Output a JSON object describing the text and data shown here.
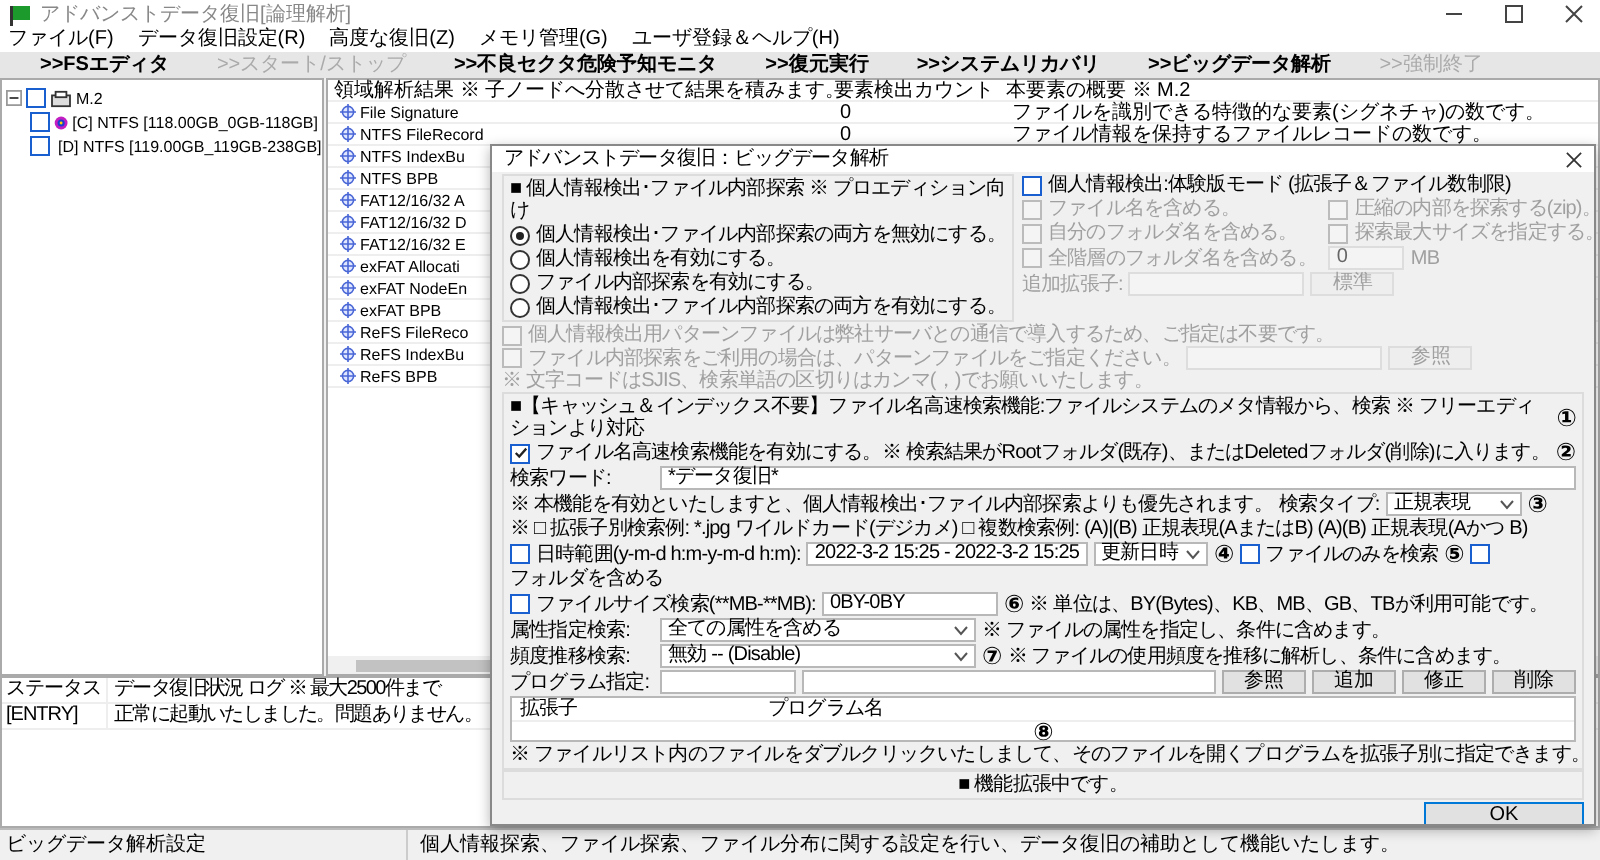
{
  "window": {
    "title": "アドバンストデータ復旧[論理解析]"
  },
  "menu": [
    "ファイル(F)",
    "データ復旧設定(R)",
    "高度な復旧(Z)",
    "メモリ管理(G)",
    "ユーザ登録＆ヘルプ(H)"
  ],
  "toolbar": [
    {
      "label": ">>FSエディタ",
      "disabled": false
    },
    {
      "label": ">>スタート/ストップ",
      "disabled": true
    },
    {
      "label": ">>不良セクタ危険予知モニタ",
      "disabled": false
    },
    {
      "label": ">>復元実行",
      "disabled": false
    },
    {
      "label": ">>システムリカバリ",
      "disabled": false
    },
    {
      "label": ">>ビッグデータ解析",
      "disabled": false
    },
    {
      "label": ">>強制終了",
      "disabled": true
    }
  ],
  "tree": {
    "label": "M.2",
    "checked": false,
    "expanded": true,
    "children": [
      {
        "label": "[C] NTFS [118.00GB_0GB-118GB]",
        "checked": false
      },
      {
        "label": "[D] NTFS [119.00GB_119GB-238GB]",
        "checked": false
      }
    ]
  },
  "table": {
    "columns": [
      "領域解析結果 ※ 子ノードへ分散させて結果を積みます。",
      "要素検出カウント",
      "本要素の概要 ※ M.2"
    ],
    "rows": [
      {
        "name": "File Signature",
        "count": "0",
        "description": "ファイルを識別できる特徴的な要素(シグネチャ)の数です。"
      },
      {
        "name": "NTFS FileRecord",
        "count": "0",
        "description": "ファイル情報を保持するファイルレコードの数です。"
      },
      {
        "name": "NTFS IndexBu"
      },
      {
        "name": "NTFS BPB"
      },
      {
        "name": "FAT12/16/32 A"
      },
      {
        "name": "FAT12/16/32 D"
      },
      {
        "name": "FAT12/16/32 E"
      },
      {
        "name": "exFAT Allocati"
      },
      {
        "name": "exFAT NodeEn"
      },
      {
        "name": "exFAT BPB"
      },
      {
        "name": "ReFS FileReco"
      },
      {
        "name": "ReFS IndexBu"
      },
      {
        "name": "ReFS BPB"
      }
    ]
  },
  "log": {
    "columns": [
      "ステータス",
      "データ復旧状況 ログ ※ 最大2500件まで"
    ],
    "rows": [
      {
        "status": "[ENTRY]",
        "message": "正常に起動いたしました。問題ありません。"
      }
    ]
  },
  "status_bar": [
    "ビッグデータ解析設定",
    "個人情報探索、ファイル探索、ファイル分布に関する設定を行い、データ復旧の補助として機能いたします。"
  ],
  "dialog": {
    "title": "アドバンストデータ復旧：ビッグデータ解析",
    "personal": {
      "title": "■ 個人情報検出･ファイル内部探索 ※ プロエディション向け",
      "options": [
        {
          "label": "個人情報検出･ファイル内部探索の両方を無効にする。",
          "selected": true
        },
        {
          "label": "個人情報検出を有効にする。",
          "selected": false
        },
        {
          "label": "ファイル内部探索を有効にする。",
          "selected": false
        },
        {
          "label": "個人情報検出･ファイル内部探索の両方を有効にする。",
          "selected": false
        }
      ],
      "trial": {
        "label": "個人情報検出:体験版モード (拡張子＆ファイル数制限)",
        "checked": false
      },
      "checks": [
        {
          "label": "ファイル名を含める。",
          "checked": false,
          "disabled": true
        },
        {
          "label": "自分のフォルダ名を含める。",
          "checked": false,
          "disabled": true
        },
        {
          "label": "全階層のフォルダ名を含める。",
          "checked": false,
          "disabled": true
        },
        {
          "label": "圧縮の内部を探索する(zip)。",
          "checked": false,
          "disabled": true
        },
        {
          "label": "探索最大サイズを指定する。",
          "checked": false,
          "disabled": true
        }
      ],
      "max_size": {
        "value": "0",
        "unit": "MB"
      },
      "extension": {
        "label": "追加拡張子:",
        "button": "標準"
      },
      "notes": [
        {
          "label": "個人情報検出用パターンファイルは弊社サーバとの通信で導入するため、ご指定は不要です。",
          "checked": false
        },
        {
          "label": "ファイル内部探索をご利用の場合は、パターンファイルをご指定ください。",
          "checked": false,
          "button": "参照"
        }
      ],
      "charset_note": "※ 文字コードはSJIS、検索単語の区切りはカンマ(，)でお願いいたします。"
    },
    "quick_search": {
      "title": "■【キャッシュ＆インデックス不要】ファイル名高速検索機能:ファイルシステムのメタ情報から、検索 ※ フリーエディションより対応",
      "enable": {
        "label": "ファイル名高速検索機能を有効にする。※ 検索結果がRootフォルダ(既存)、またはDeletedフォルダ(削除)に入ります。",
        "checked": true
      },
      "word": {
        "label": "検索ワード:",
        "value": "*データ復旧*"
      },
      "priority_note": "※ 本機能を有効といたしますと、個人情報検出･ファイル内部探索よりも優先されます。",
      "type": {
        "label": "検索タイプ:",
        "value": "正規表現"
      },
      "examples": "※ □ 拡張子別検索例: *.jpg ワイルドカード(デジカメ) □ 複数検索例: (A)|(B) 正規表現(AまたはB) (A)(B) 正規表現(Aかつ B)",
      "date": {
        "label": "日時範囲(y-m-d h:m-y-m-d h:m):",
        "checked": false,
        "value": "2022-3-2 15:25 - 2022-3-2 15:25",
        "mode": "更新日時"
      },
      "file_only": {
        "label": "ファイルのみを検索",
        "checked": false
      },
      "include_folders": {
        "label": "フォルダを含める",
        "checked": false
      },
      "size": {
        "label": "ファイルサイズ検索(**MB-**MB):",
        "checked": false,
        "value": "0BY-0BY",
        "note": "※ 単位は、BY(Bytes)、KB、MB、GB、TBが利用可能です。"
      },
      "attribute": {
        "label": "属性指定検索:",
        "value": "全ての属性を含める",
        "note": "※ ファイルの属性を指定し、条件に含めます。"
      },
      "frequency": {
        "label": "頻度推移検索:",
        "value": "無効 -- (Disable)",
        "note": "※ ファイルの使用頻度を推移に解析し、条件に含めます。"
      },
      "program": {
        "label": "プログラム指定:",
        "buttons": [
          "参照",
          "追加",
          "修正",
          "削除"
        ]
      },
      "program_list": {
        "columns": [
          "拡張子",
          "プログラム名"
        ]
      },
      "list_note": "※ ファイルリスト内のファイルをダブルクリックいたしまして、そのファイルを開くプログラムを拡張子別に指定できます。"
    },
    "extension_note": "■ 機能拡張中です。",
    "ok": "OK",
    "annotations": [
      "①",
      "②",
      "③",
      "④",
      "⑤",
      "⑥",
      "⑦",
      "⑧"
    ]
  }
}
